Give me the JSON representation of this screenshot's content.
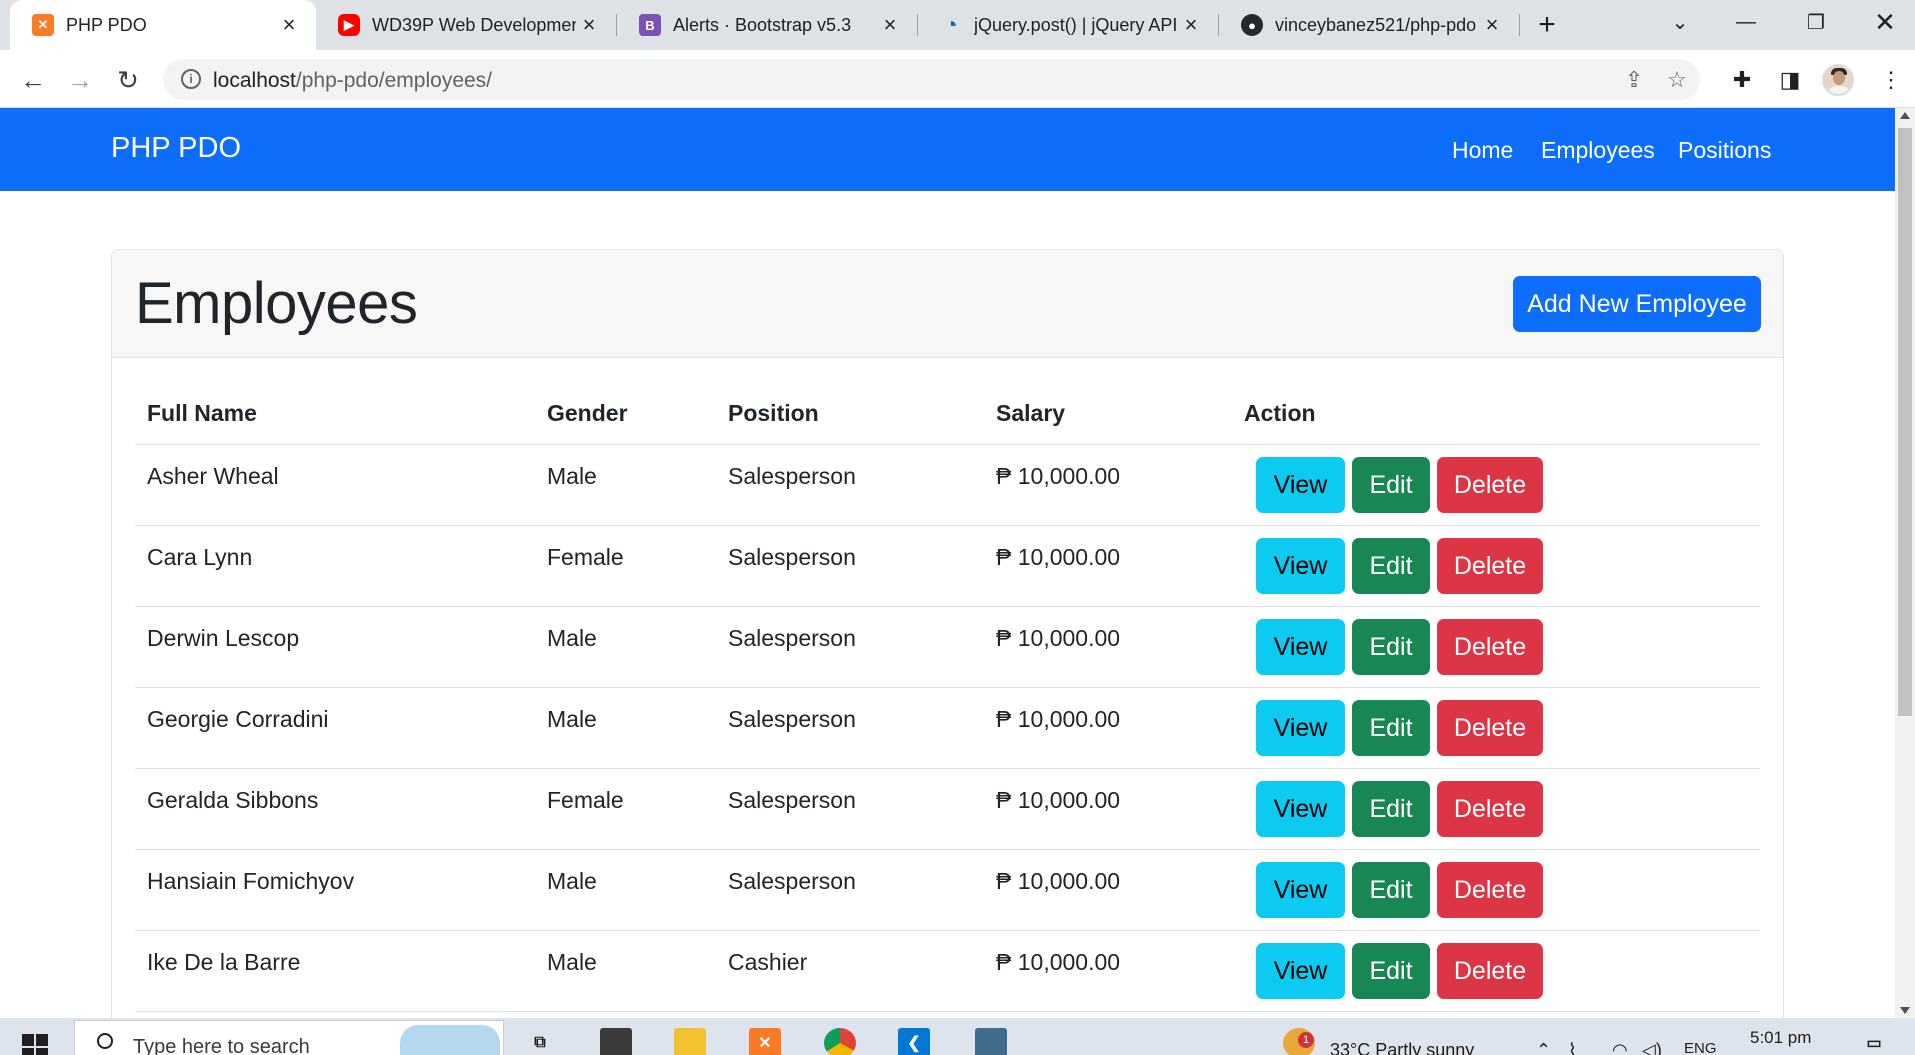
{
  "browser": {
    "tabs": [
      {
        "title": "PHP PDO",
        "favicon": "xampp-icon",
        "active": true
      },
      {
        "title": "WD39P Web Developmen",
        "favicon": "youtube-icon",
        "active": false
      },
      {
        "title": "Alerts · Bootstrap v5.3",
        "favicon": "bootstrap-icon",
        "active": false
      },
      {
        "title": "jQuery.post() | jQuery API",
        "favicon": "jquery-icon",
        "active": false
      },
      {
        "title": "vinceybanez521/php-pdo",
        "favicon": "github-icon",
        "active": false
      }
    ],
    "address": {
      "host": "localhost",
      "path": "/php-pdo/employees/"
    }
  },
  "site": {
    "brand": "PHP PDO",
    "nav": {
      "home": "Home",
      "employees": "Employees",
      "positions": "Positions"
    },
    "primary_color": "#0d6efd"
  },
  "page": {
    "title": "Employees",
    "add_button": "Add New Employee",
    "table": {
      "headers": {
        "name": "Full Name",
        "gender": "Gender",
        "position": "Position",
        "salary": "Salary",
        "action": "Action"
      },
      "rows": [
        {
          "name": "Asher Wheal",
          "gender": "Male",
          "position": "Salesperson",
          "salary": "₱ 10,000.00"
        },
        {
          "name": "Cara Lynn",
          "gender": "Female",
          "position": "Salesperson",
          "salary": "₱ 10,000.00"
        },
        {
          "name": "Derwin Lescop",
          "gender": "Male",
          "position": "Salesperson",
          "salary": "₱ 10,000.00"
        },
        {
          "name": "Georgie Corradini",
          "gender": "Male",
          "position": "Salesperson",
          "salary": "₱ 10,000.00"
        },
        {
          "name": "Geralda Sibbons",
          "gender": "Female",
          "position": "Salesperson",
          "salary": "₱ 10,000.00"
        },
        {
          "name": "Hansiain Fomichyov",
          "gender": "Male",
          "position": "Salesperson",
          "salary": "₱ 10,000.00"
        },
        {
          "name": "Ike De la Barre",
          "gender": "Male",
          "position": "Cashier",
          "salary": "₱ 10,000.00"
        }
      ],
      "actions": {
        "view": "View",
        "edit": "Edit",
        "delete": "Delete"
      }
    }
  },
  "taskbar": {
    "search_placeholder": "Type here to search",
    "weather": "33°C  Partly sunny",
    "language": "ENG",
    "time": "5:01 pm",
    "notification_count": "1"
  }
}
